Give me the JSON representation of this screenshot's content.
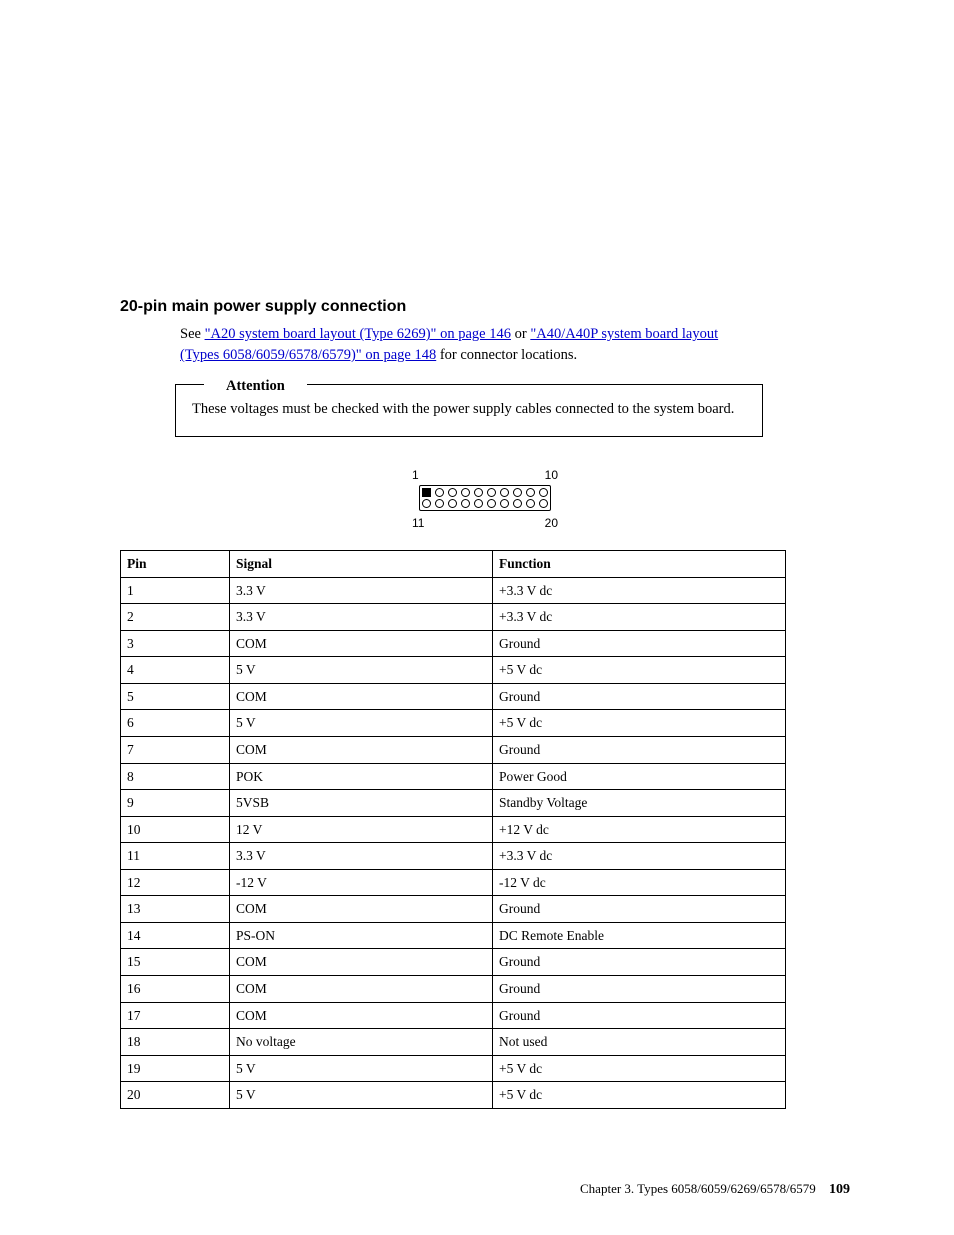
{
  "heading": "20-pin main power supply connection",
  "intro": {
    "see": "See ",
    "link1": "\"A20 system board layout (Type 6269)\" on page 146",
    "or": " or ",
    "link2a": "\"A40/A40P system board layout",
    "link2b": "(Types 6058/6059/6578/6579)\" on page 148",
    "tail": " for connector locations."
  },
  "attention": {
    "label": "Attention",
    "text": "These voltages must be checked with the power supply cables connected to the system board."
  },
  "connector": {
    "tl": "1",
    "tr": "10",
    "bl": "11",
    "br": "20"
  },
  "table": {
    "header": {
      "pin": "Pin",
      "signal": "Signal",
      "function": "Function"
    },
    "rows": [
      {
        "pin": "1",
        "signal": "3.3 V",
        "function": "+3.3 V dc"
      },
      {
        "pin": "2",
        "signal": "3.3 V",
        "function": "+3.3 V dc"
      },
      {
        "pin": "3",
        "signal": "COM",
        "function": "Ground"
      },
      {
        "pin": "4",
        "signal": "5 V",
        "function": "+5 V dc"
      },
      {
        "pin": "5",
        "signal": "COM",
        "function": "Ground"
      },
      {
        "pin": "6",
        "signal": "5 V",
        "function": "+5 V dc"
      },
      {
        "pin": "7",
        "signal": "COM",
        "function": "Ground"
      },
      {
        "pin": "8",
        "signal": "POK",
        "function": "Power Good"
      },
      {
        "pin": "9",
        "signal": "5VSB",
        "function": "Standby Voltage"
      },
      {
        "pin": "10",
        "signal": "12 V",
        "function": "+12 V dc"
      },
      {
        "pin": "11",
        "signal": "3.3 V",
        "function": "+3.3 V dc"
      },
      {
        "pin": "12",
        "signal": "-12 V",
        "function": "-12 V dc"
      },
      {
        "pin": "13",
        "signal": "COM",
        "function": "Ground"
      },
      {
        "pin": "14",
        "signal": "PS-ON",
        "function": "DC Remote Enable"
      },
      {
        "pin": "15",
        "signal": "COM",
        "function": "Ground"
      },
      {
        "pin": "16",
        "signal": "COM",
        "function": "Ground"
      },
      {
        "pin": "17",
        "signal": "COM",
        "function": "Ground"
      },
      {
        "pin": "18",
        "signal": "No voltage",
        "function": "Not used"
      },
      {
        "pin": "19",
        "signal": "5 V",
        "function": "+5 V dc"
      },
      {
        "pin": "20",
        "signal": "5 V",
        "function": "+5 V dc"
      }
    ]
  },
  "footer": {
    "chapter": "Chapter 3. Types 6058/6059/6269/6578/6579",
    "pagenum": "109"
  }
}
